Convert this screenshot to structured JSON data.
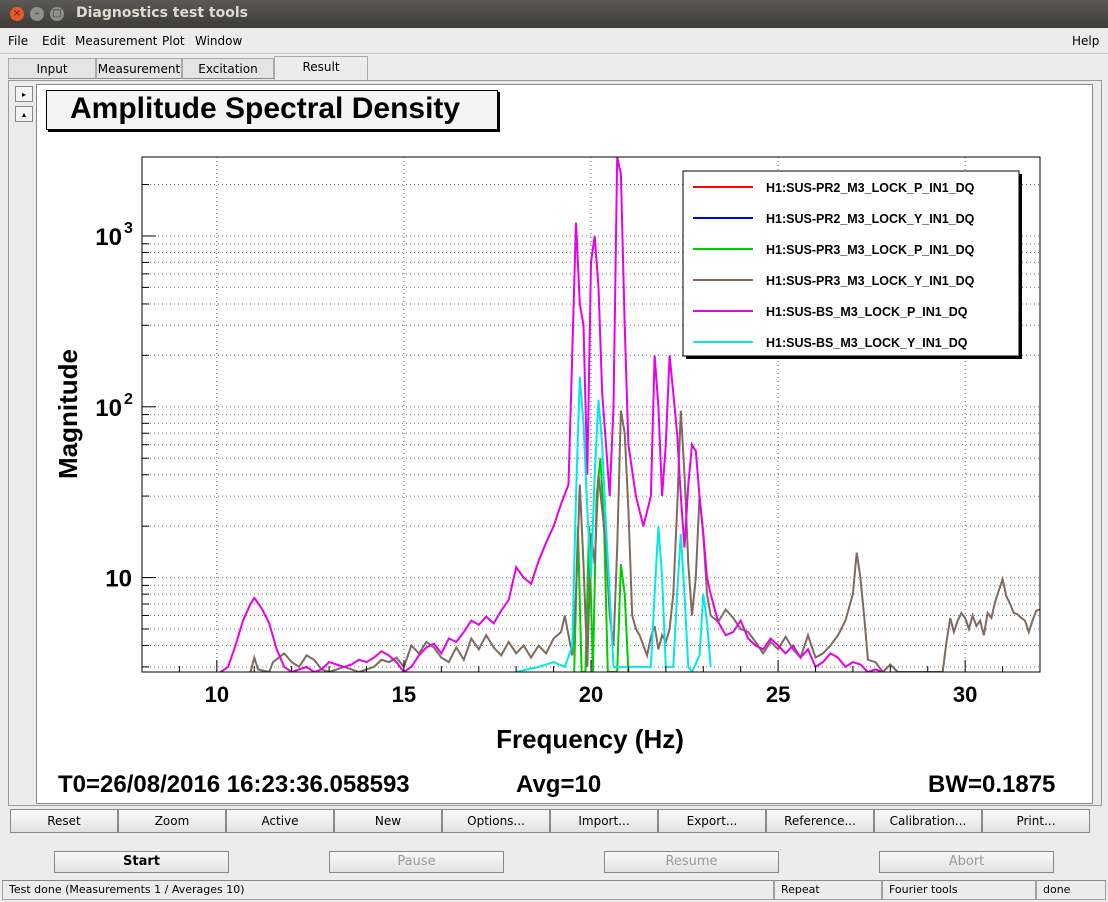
{
  "window": {
    "title": "Diagnostics test tools",
    "close_glyph": "×",
    "min_glyph": "–",
    "max_glyph": "□"
  },
  "menu": {
    "file": "File",
    "edit": "Edit",
    "measurement": "Measurement",
    "plot": "Plot",
    "window": "Window",
    "help": "Help"
  },
  "tabs": [
    {
      "label": "Input"
    },
    {
      "label": "Measurement"
    },
    {
      "label": "Excitation"
    },
    {
      "label": "Result"
    }
  ],
  "side_buttons": {
    "right_glyph": "▸",
    "up_glyph": "▴"
  },
  "plot": {
    "title": "Amplitude Spectral Density",
    "t0": "T0=26/08/2016 16:23:36.058593",
    "avg": "Avg=10",
    "bw": "BW=0.1875"
  },
  "chart_data": {
    "type": "line",
    "title": "Amplitude Spectral Density",
    "xlabel": "Frequency (Hz)",
    "ylabel": "Magnitude",
    "xlim": [
      8,
      32
    ],
    "ylim": [
      2.8,
      2900
    ],
    "yscale": "log",
    "grid": true,
    "legend_position": "top-right",
    "x_ticks": [
      "10",
      "15",
      "20",
      "25",
      "30"
    ],
    "x_tick_values": [
      10,
      15,
      20,
      25,
      30
    ],
    "y_ticks": [
      {
        "base": "10",
        "exp": "",
        "value": 10
      },
      {
        "base": "10",
        "exp": "2",
        "value": 100
      },
      {
        "base": "10",
        "exp": "3",
        "value": 1000
      }
    ],
    "series": [
      {
        "name": "H1:SUS-PR2_M3_LOCK_P_IN1_DQ",
        "color": "#ff0000",
        "points": []
      },
      {
        "name": "H1:SUS-PR2_M3_LOCK_Y_IN1_DQ",
        "color": "#0000ff",
        "points": []
      },
      {
        "name": "H1:SUS-PR3_M3_LOCK_P_IN1_DQ",
        "color": "#00cc00",
        "points": [
          [
            19.55,
            2.8
          ],
          [
            19.65,
            20
          ],
          [
            19.75,
            2.8
          ],
          [
            19.85,
            2.8
          ],
          [
            19.95,
            20
          ],
          [
            20.05,
            2.8
          ],
          [
            20.15,
            30
          ],
          [
            20.25,
            50
          ],
          [
            20.35,
            20
          ],
          [
            20.45,
            2.8
          ],
          [
            20.7,
            2.8
          ],
          [
            20.8,
            12
          ],
          [
            20.9,
            8
          ],
          [
            21.0,
            2.8
          ]
        ]
      },
      {
        "name": "H1:SUS-PR3_M3_LOCK_Y_IN1_DQ",
        "color": "#7f6a60",
        "points": [
          [
            10.9,
            2.8
          ],
          [
            11.0,
            3.4
          ],
          [
            11.1,
            2.9
          ],
          [
            11.4,
            2.8
          ],
          [
            11.5,
            3.2
          ],
          [
            11.8,
            3.6
          ],
          [
            12.0,
            3.2
          ],
          [
            12.2,
            3.0
          ],
          [
            12.4,
            3.5
          ],
          [
            12.6,
            3.3
          ],
          [
            12.8,
            2.9
          ],
          [
            13.0,
            2.8
          ],
          [
            13.4,
            3.0
          ],
          [
            13.6,
            2.9
          ],
          [
            13.8,
            2.8
          ],
          [
            14.2,
            3.0
          ],
          [
            14.4,
            3.3
          ],
          [
            14.6,
            3.2
          ],
          [
            14.8,
            3.4
          ],
          [
            15.0,
            3.0
          ],
          [
            15.2,
            4.0
          ],
          [
            15.4,
            3.6
          ],
          [
            15.6,
            4.2
          ],
          [
            15.8,
            3.9
          ],
          [
            16.0,
            3.4
          ],
          [
            16.2,
            3.2
          ],
          [
            16.4,
            3.9
          ],
          [
            16.6,
            3.3
          ],
          [
            16.8,
            4.4
          ],
          [
            17.0,
            3.8
          ],
          [
            17.2,
            4.6
          ],
          [
            17.4,
            3.9
          ],
          [
            17.6,
            3.5
          ],
          [
            17.8,
            4.2
          ],
          [
            18.0,
            3.6
          ],
          [
            18.2,
            4.0
          ],
          [
            18.4,
            3.4
          ],
          [
            18.6,
            4.0
          ],
          [
            18.8,
            3.6
          ],
          [
            19.0,
            4.4
          ],
          [
            19.2,
            4.8
          ],
          [
            19.3,
            6.0
          ],
          [
            19.5,
            3.5
          ],
          [
            19.6,
            8
          ],
          [
            19.7,
            35
          ],
          [
            19.8,
            12
          ],
          [
            19.9,
            3.0
          ],
          [
            20.0,
            18
          ],
          [
            20.1,
            12
          ],
          [
            20.2,
            40
          ],
          [
            20.3,
            25
          ],
          [
            20.4,
            15
          ],
          [
            20.5,
            6
          ],
          [
            20.6,
            4.0
          ],
          [
            20.7,
            15
          ],
          [
            20.8,
            95
          ],
          [
            20.9,
            70
          ],
          [
            21.0,
            25
          ],
          [
            21.1,
            6
          ],
          [
            21.2,
            5
          ],
          [
            21.3,
            4.6
          ],
          [
            21.4,
            4.0
          ],
          [
            21.5,
            3.5
          ],
          [
            21.6,
            4.5
          ],
          [
            21.7,
            5.2
          ],
          [
            21.8,
            3.8
          ],
          [
            21.9,
            4.6
          ],
          [
            22.0,
            4.2
          ],
          [
            22.1,
            5.0
          ],
          [
            22.2,
            8
          ],
          [
            22.3,
            25
          ],
          [
            22.4,
            95
          ],
          [
            22.5,
            40
          ],
          [
            22.6,
            12
          ],
          [
            22.7,
            6
          ],
          [
            22.8,
            10
          ],
          [
            22.9,
            30
          ],
          [
            23.0,
            18
          ],
          [
            23.1,
            8
          ],
          [
            23.2,
            6
          ],
          [
            23.4,
            5.5
          ],
          [
            23.6,
            6.5
          ],
          [
            23.8,
            5.8
          ],
          [
            24.0,
            5.0
          ],
          [
            24.2,
            4.8
          ],
          [
            24.4,
            4.2
          ],
          [
            24.6,
            3.6
          ],
          [
            24.8,
            4.2
          ],
          [
            25.0,
            3.8
          ],
          [
            25.2,
            4.5
          ],
          [
            25.4,
            3.8
          ],
          [
            25.6,
            3.4
          ],
          [
            25.8,
            4.6
          ],
          [
            26.0,
            3.4
          ],
          [
            26.2,
            3.6
          ],
          [
            26.4,
            4.0
          ],
          [
            26.6,
            4.6
          ],
          [
            26.8,
            5.6
          ],
          [
            27.0,
            8
          ],
          [
            27.1,
            14
          ],
          [
            27.2,
            10
          ],
          [
            27.3,
            6
          ],
          [
            27.4,
            3.3
          ],
          [
            27.6,
            3.2
          ],
          [
            27.8,
            2.8
          ],
          [
            28.0,
            3.1
          ],
          [
            28.2,
            2.8
          ],
          [
            29.4,
            2.8
          ],
          [
            29.5,
            4.2
          ],
          [
            29.6,
            5.8
          ],
          [
            29.7,
            4.8
          ],
          [
            29.8,
            5.6
          ],
          [
            29.9,
            6.2
          ],
          [
            30.0,
            5.8
          ],
          [
            30.1,
            5.0
          ],
          [
            30.2,
            6.0
          ],
          [
            30.3,
            5.2
          ],
          [
            30.4,
            5.6
          ],
          [
            30.5,
            4.6
          ],
          [
            30.6,
            6.2
          ],
          [
            30.7,
            5.8
          ],
          [
            30.8,
            7.2
          ],
          [
            30.9,
            8.4
          ],
          [
            31.0,
            9.8
          ],
          [
            31.1,
            7.8
          ],
          [
            31.2,
            7.0
          ],
          [
            31.3,
            6.2
          ],
          [
            31.4,
            6.1
          ],
          [
            31.5,
            5.8
          ],
          [
            31.6,
            5.6
          ],
          [
            31.7,
            4.8
          ],
          [
            31.8,
            5.6
          ],
          [
            31.9,
            6.4
          ],
          [
            32.0,
            6.5
          ]
        ]
      },
      {
        "name": "H1:SUS-BS_M3_LOCK_P_IN1_DQ",
        "color": "#e800e8",
        "points": [
          [
            10.1,
            2.8
          ],
          [
            10.3,
            3.0
          ],
          [
            10.5,
            4.0
          ],
          [
            10.7,
            5.6
          ],
          [
            10.9,
            7.0
          ],
          [
            11.0,
            7.6
          ],
          [
            11.2,
            6.6
          ],
          [
            11.4,
            5.4
          ],
          [
            11.6,
            3.8
          ],
          [
            11.8,
            3.0
          ],
          [
            12.0,
            2.8
          ],
          [
            12.4,
            3.0
          ],
          [
            12.6,
            2.8
          ],
          [
            12.8,
            2.9
          ],
          [
            13.0,
            3.2
          ],
          [
            13.2,
            3.1
          ],
          [
            13.4,
            3.0
          ],
          [
            13.6,
            3.1
          ],
          [
            13.8,
            3.3
          ],
          [
            14.0,
            3.2
          ],
          [
            14.2,
            3.4
          ],
          [
            14.4,
            3.7
          ],
          [
            14.6,
            3.5
          ],
          [
            14.8,
            3.2
          ],
          [
            15.0,
            2.8
          ],
          [
            15.2,
            3.0
          ],
          [
            15.4,
            3.5
          ],
          [
            15.6,
            3.9
          ],
          [
            15.8,
            4.1
          ],
          [
            16.0,
            3.6
          ],
          [
            16.2,
            4.4
          ],
          [
            16.4,
            4.2
          ],
          [
            16.6,
            4.8
          ],
          [
            16.8,
            5.6
          ],
          [
            17.0,
            5.3
          ],
          [
            17.2,
            5.9
          ],
          [
            17.4,
            5.4
          ],
          [
            17.6,
            6.4
          ],
          [
            17.8,
            7.4
          ],
          [
            18.0,
            11.5
          ],
          [
            18.2,
            10.0
          ],
          [
            18.4,
            9.2
          ],
          [
            18.6,
            12.5
          ],
          [
            18.8,
            16
          ],
          [
            19.0,
            20
          ],
          [
            19.2,
            27
          ],
          [
            19.4,
            35
          ],
          [
            19.6,
            1200
          ],
          [
            19.7,
            400
          ],
          [
            19.8,
            300
          ],
          [
            19.9,
            40
          ],
          [
            20.0,
            700
          ],
          [
            20.1,
            1000
          ],
          [
            20.2,
            500
          ],
          [
            20.3,
            120
          ],
          [
            20.4,
            60
          ],
          [
            20.5,
            30
          ],
          [
            20.6,
            100
          ],
          [
            20.7,
            2900
          ],
          [
            20.8,
            2300
          ],
          [
            20.9,
            300
          ],
          [
            21.0,
            60
          ],
          [
            21.2,
            30
          ],
          [
            21.4,
            20
          ],
          [
            21.6,
            30
          ],
          [
            21.7,
            200
          ],
          [
            21.8,
            100
          ],
          [
            21.9,
            30
          ],
          [
            22.0,
            60
          ],
          [
            22.1,
            200
          ],
          [
            22.2,
            120
          ],
          [
            22.3,
            70
          ],
          [
            22.4,
            30
          ],
          [
            22.5,
            15
          ],
          [
            22.6,
            35
          ],
          [
            22.7,
            60
          ],
          [
            22.8,
            55
          ],
          [
            22.9,
            30
          ],
          [
            23.0,
            18
          ],
          [
            23.1,
            10
          ],
          [
            23.2,
            8
          ],
          [
            23.4,
            5.5
          ],
          [
            23.6,
            4.6
          ],
          [
            23.8,
            4.8
          ],
          [
            24.0,
            5.6
          ],
          [
            24.2,
            4.4
          ],
          [
            24.4,
            4.0
          ],
          [
            24.6,
            3.8
          ],
          [
            24.8,
            4.4
          ],
          [
            25.0,
            4.0
          ],
          [
            25.2,
            3.6
          ],
          [
            25.4,
            4.0
          ],
          [
            25.6,
            3.4
          ],
          [
            25.8,
            3.8
          ],
          [
            26.0,
            3.0
          ],
          [
            26.2,
            3.2
          ],
          [
            26.4,
            3.6
          ],
          [
            26.6,
            3.4
          ],
          [
            26.8,
            3.0
          ],
          [
            27.0,
            3.2
          ],
          [
            27.2,
            3.1
          ],
          [
            27.4,
            2.8
          ],
          [
            27.6,
            2.9
          ],
          [
            27.8,
            2.8
          ]
        ]
      },
      {
        "name": "H1:SUS-BS_M3_LOCK_Y_IN1_DQ",
        "color": "#00e8e8",
        "points": [
          [
            18.0,
            2.8
          ],
          [
            18.3,
            2.9
          ],
          [
            18.6,
            3.0
          ],
          [
            19.0,
            3.2
          ],
          [
            19.3,
            3.0
          ],
          [
            19.5,
            4.0
          ],
          [
            19.6,
            30
          ],
          [
            19.7,
            150
          ],
          [
            19.8,
            80
          ],
          [
            19.9,
            25
          ],
          [
            20.0,
            10
          ],
          [
            20.1,
            40
          ],
          [
            20.2,
            110
          ],
          [
            20.3,
            60
          ],
          [
            20.4,
            20
          ],
          [
            20.5,
            8
          ],
          [
            20.6,
            3.0
          ],
          [
            21.6,
            3.0
          ],
          [
            21.7,
            8
          ],
          [
            21.8,
            20
          ],
          [
            21.9,
            10
          ],
          [
            22.0,
            3.0
          ],
          [
            22.2,
            3.0
          ],
          [
            22.3,
            8
          ],
          [
            22.4,
            18
          ],
          [
            22.5,
            8
          ],
          [
            22.6,
            3.0
          ],
          [
            22.7,
            2.8
          ],
          [
            22.9,
            3.5
          ],
          [
            23.0,
            8
          ],
          [
            23.1,
            5.5
          ],
          [
            23.2,
            3.0
          ]
        ]
      }
    ]
  },
  "buttons": {
    "reset": "Reset",
    "zoom": "Zoom",
    "active": "Active",
    "new": "New",
    "options": "Options...",
    "import": "Import...",
    "export": "Export...",
    "reference": "Reference...",
    "calibration": "Calibration...",
    "print": "Print..."
  },
  "controls": {
    "start": "Start",
    "pause": "Pause",
    "resume": "Resume",
    "abort": "Abort"
  },
  "status": {
    "message": "Test done (Measurements 1 / Averages 10)",
    "mode": "Repeat",
    "tool": "Fourier tools",
    "state": "done"
  }
}
